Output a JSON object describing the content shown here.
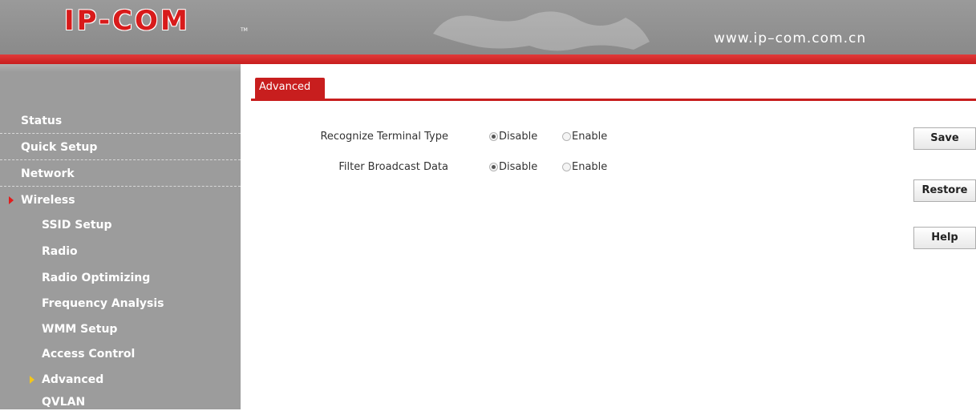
{
  "header": {
    "logo_text": "IP-COM",
    "logo_tm": "TM",
    "site_url": "www.ip–com.com.cn"
  },
  "sidebar": {
    "items": [
      {
        "label": "Status",
        "level": "top"
      },
      {
        "label": "Quick Setup",
        "level": "top"
      },
      {
        "label": "Network",
        "level": "top"
      },
      {
        "label": "Wireless",
        "level": "top",
        "expanded": true
      },
      {
        "label": "SSID Setup",
        "level": "sub"
      },
      {
        "label": "Radio",
        "level": "sub"
      },
      {
        "label": "Radio Optimizing",
        "level": "sub"
      },
      {
        "label": "Frequency Analysis",
        "level": "sub"
      },
      {
        "label": "WMM Setup",
        "level": "sub"
      },
      {
        "label": "Access Control",
        "level": "sub"
      },
      {
        "label": "Advanced",
        "level": "sub",
        "active": true
      },
      {
        "label": "QVLAN",
        "level": "sub"
      }
    ]
  },
  "main": {
    "tab_label": "Advanced",
    "fields": [
      {
        "label": "Recognize Terminal Type",
        "options": [
          "Disable",
          "Enable"
        ],
        "selected": "Disable"
      },
      {
        "label": "Filter Broadcast Data",
        "options": [
          "Disable",
          "Enable"
        ],
        "selected": "Disable"
      }
    ]
  },
  "buttons": {
    "save": "Save",
    "restore": "Restore",
    "help": "Help"
  },
  "colors": {
    "brand_red": "#c81e1e",
    "sidebar_gray": "#9c9c9c",
    "active_arrow": "#f3c61a"
  }
}
